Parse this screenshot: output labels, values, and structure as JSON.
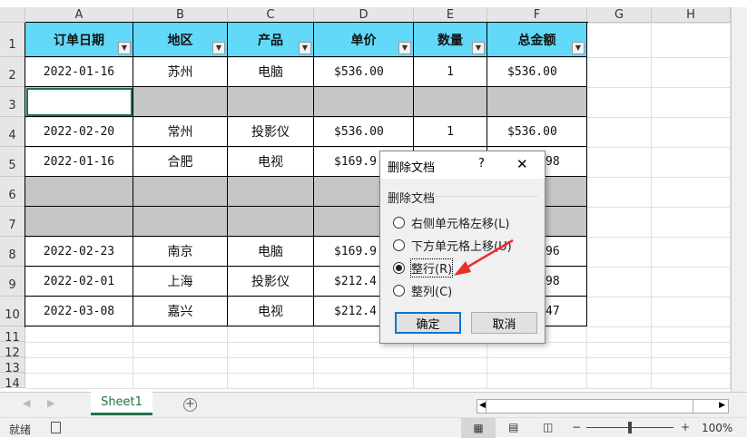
{
  "columns": [
    "A",
    "B",
    "C",
    "D",
    "E",
    "F",
    "G",
    "H"
  ],
  "rows": [
    "1",
    "2",
    "3",
    "4",
    "5",
    "6",
    "7",
    "8",
    "9",
    "10",
    "11",
    "12",
    "13",
    "14"
  ],
  "headers": [
    "订单日期",
    "地区",
    "产品",
    "单价",
    "数量",
    "总金额"
  ],
  "data": [
    [
      "2022-01-16",
      "苏州",
      "电脑",
      "$536.00",
      "1",
      "$536.00"
    ],
    [
      "",
      "",
      "",
      "",
      "",
      ""
    ],
    [
      "2022-02-20",
      "常州",
      "投影仪",
      "$536.00",
      "1",
      "$536.00"
    ],
    [
      "2022-01-16",
      "合肥",
      "电视",
      "$169.9",
      "",
      "98"
    ],
    [
      "",
      "",
      "",
      "",
      "",
      ""
    ],
    [
      "",
      "",
      "",
      "",
      "",
      ""
    ],
    [
      "2022-02-23",
      "南京",
      "电脑",
      "$169.9",
      "",
      "96"
    ],
    [
      "2022-02-01",
      "上海",
      "投影仪",
      "$212.4",
      "",
      "98"
    ],
    [
      "2022-03-08",
      "嘉兴",
      "电视",
      "$212.4",
      "",
      "47"
    ]
  ],
  "gray_rows": [
    3,
    6,
    7
  ],
  "colors": {
    "header_fill": "#62d9f8",
    "blank_row_fill": "#c6c6c6",
    "accent": "#217346",
    "arrow": "#e8302a"
  },
  "dialog": {
    "title": "删除文档",
    "help": "?",
    "close": "✕",
    "group": "删除文档",
    "options": [
      {
        "label": "右侧单元格左移(L)",
        "selected": false
      },
      {
        "label": "下方单元格上移(U)",
        "selected": false
      },
      {
        "label": "整行(R)",
        "selected": true
      },
      {
        "label": "整列(C)",
        "selected": false
      }
    ],
    "ok": "确定",
    "cancel": "取消"
  },
  "sheet_tab": "Sheet1",
  "status": {
    "ready": "就绪",
    "zoom": "100%",
    "zoom_minus": "−",
    "zoom_plus": "+"
  }
}
